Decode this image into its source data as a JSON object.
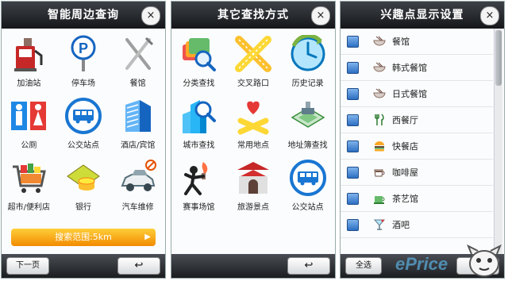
{
  "panel1": {
    "title": "智能周边查询",
    "close": "×",
    "items": [
      {
        "label": "加油站",
        "icon": "gas-station-icon"
      },
      {
        "label": "停车场",
        "icon": "parking-icon"
      },
      {
        "label": "餐馆",
        "icon": "restaurant-icon"
      },
      {
        "label": "公厕",
        "icon": "restroom-icon"
      },
      {
        "label": "公交站点",
        "icon": "bus-icon"
      },
      {
        "label": "酒店/宾馆",
        "icon": "hotel-icon"
      },
      {
        "label": "超市/便利店",
        "icon": "shopping-cart-icon"
      },
      {
        "label": "银行",
        "icon": "bank-icon"
      },
      {
        "label": "汽车维修",
        "icon": "car-repair-icon"
      }
    ],
    "range": "搜索范围:5km",
    "range_arrow": "▶",
    "next": "下一页",
    "back": "↩"
  },
  "panel2": {
    "title": "其它查找方式",
    "close": "×",
    "items": [
      {
        "label": "分类查找",
        "icon": "category-search-icon"
      },
      {
        "label": "交叉路口",
        "icon": "intersection-icon"
      },
      {
        "label": "历史记录",
        "icon": "history-clock-icon"
      },
      {
        "label": "城市查找",
        "icon": "city-search-icon"
      },
      {
        "label": "常用地点",
        "icon": "favorite-place-icon"
      },
      {
        "label": "地址簿查找",
        "icon": "address-book-icon"
      },
      {
        "label": "赛事场馆",
        "icon": "stadium-torch-icon"
      },
      {
        "label": "旅游景点",
        "icon": "scenic-gate-icon"
      },
      {
        "label": "公交站点",
        "icon": "bus-icon"
      }
    ],
    "back": "↩"
  },
  "panel3": {
    "title": "兴趣点显示设置",
    "close": "×",
    "items": [
      {
        "label": "餐馆",
        "icon": "bowl-icon"
      },
      {
        "label": "韩式餐馆",
        "icon": "bowl-icon"
      },
      {
        "label": "日式餐馆",
        "icon": "bowl-icon"
      },
      {
        "label": "西餐厅",
        "icon": "fork-knife-icon"
      },
      {
        "label": "快餐店",
        "icon": "burger-icon"
      },
      {
        "label": "咖啡屋",
        "icon": "coffee-icon"
      },
      {
        "label": "茶艺馆",
        "icon": "tea-icon"
      },
      {
        "label": "酒吧",
        "icon": "cocktail-icon"
      }
    ],
    "select_all": "全选",
    "back": "↩"
  },
  "watermark": "ePrice",
  "colors": {
    "header": "#2a2d31",
    "accent_orange": "#f5a000",
    "checkbox_blue": "#3b7fd0"
  }
}
